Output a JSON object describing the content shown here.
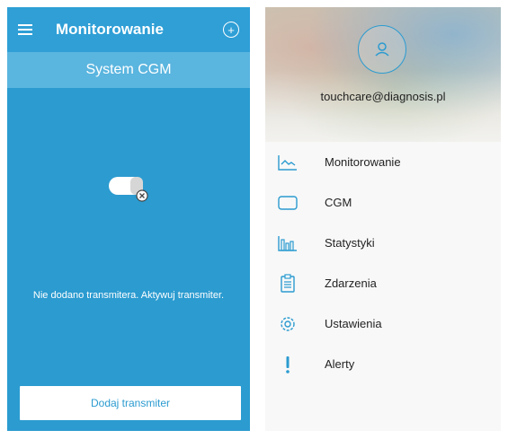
{
  "left_screen": {
    "header": {
      "title": "Monitorowanie"
    },
    "subheader": {
      "title": "System CGM"
    },
    "empty_message": "Nie dodano transmitera. Aktywuj transmiter.",
    "add_button_label": "Dodaj transmiter"
  },
  "right_screen": {
    "user": {
      "email": "touchcare@diagnosis.pl"
    },
    "menu": [
      {
        "label": "Monitorowanie",
        "icon": "chart-line-icon"
      },
      {
        "label": "CGM",
        "icon": "device-icon"
      },
      {
        "label": "Statystyki",
        "icon": "bar-chart-icon"
      },
      {
        "label": "Zdarzenia",
        "icon": "clipboard-icon"
      },
      {
        "label": "Ustawienia",
        "icon": "gear-icon"
      },
      {
        "label": "Alerty",
        "icon": "alert-icon"
      }
    ]
  },
  "colors": {
    "primary": "#2b9bd0",
    "subheader": "#5ab5df",
    "text": "#222222"
  }
}
